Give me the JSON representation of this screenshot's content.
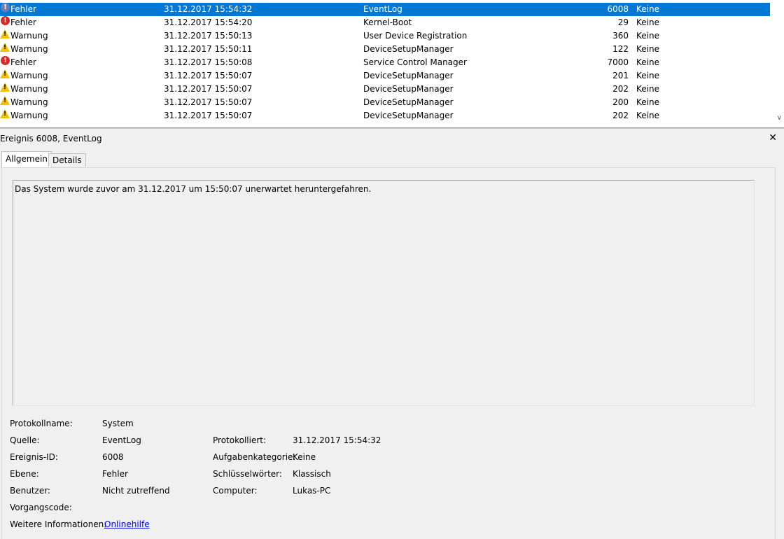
{
  "events": [
    {
      "level": "Fehler",
      "icon": "error-icon",
      "date": "31.12.2017 15:54:32",
      "source": "EventLog",
      "id": "6008",
      "category": "Keine",
      "selected": true
    },
    {
      "level": "Fehler",
      "icon": "error-icon",
      "date": "31.12.2017 15:54:20",
      "source": "Kernel-Boot",
      "id": "29",
      "category": "Keine"
    },
    {
      "level": "Warnung",
      "icon": "warning-icon",
      "date": "31.12.2017 15:50:13",
      "source": "User Device Registration",
      "id": "360",
      "category": "Keine"
    },
    {
      "level": "Warnung",
      "icon": "warning-icon",
      "date": "31.12.2017 15:50:11",
      "source": "DeviceSetupManager",
      "id": "122",
      "category": "Keine"
    },
    {
      "level": "Fehler",
      "icon": "error-icon",
      "date": "31.12.2017 15:50:08",
      "source": "Service Control Manager",
      "id": "7000",
      "category": "Keine"
    },
    {
      "level": "Warnung",
      "icon": "warning-icon",
      "date": "31.12.2017 15:50:07",
      "source": "DeviceSetupManager",
      "id": "201",
      "category": "Keine"
    },
    {
      "level": "Warnung",
      "icon": "warning-icon",
      "date": "31.12.2017 15:50:07",
      "source": "DeviceSetupManager",
      "id": "202",
      "category": "Keine"
    },
    {
      "level": "Warnung",
      "icon": "warning-icon",
      "date": "31.12.2017 15:50:07",
      "source": "DeviceSetupManager",
      "id": "200",
      "category": "Keine"
    },
    {
      "level": "Warnung",
      "icon": "warning-icon",
      "date": "31.12.2017 15:50:07",
      "source": "DeviceSetupManager",
      "id": "202",
      "category": "Keine"
    }
  ],
  "detail": {
    "title": "Ereignis 6008, EventLog",
    "close_icon": "close-icon",
    "tabs": [
      "Allgemein",
      "Details"
    ],
    "message": "Das System wurde zuvor am 31.12.2017 um 15:50:07 unerwartet heruntergefahren.",
    "fields": {
      "log_name_label": "Protokollname:",
      "log_name": "System",
      "source_label": "Quelle:",
      "source": "EventLog",
      "logged_label": "Protokolliert:",
      "logged": "31.12.2017 15:54:32",
      "event_id_label": "Ereignis-ID:",
      "event_id": "6008",
      "task_category_label": "Aufgabenkategorie:",
      "task_category": "Keine",
      "level_label": "Ebene:",
      "level": "Fehler",
      "keywords_label": "Schlüsselwörter:",
      "keywords": "Klassisch",
      "user_label": "Benutzer:",
      "user": "Nicht zutreffend",
      "computer_label": "Computer:",
      "computer": "Lukas-PC",
      "opcode_label": "Vorgangscode:",
      "more_info_label": "Weitere Informationen:",
      "more_info_link": "Onlinehilfe"
    }
  },
  "colors": {
    "selection": "#0078d7",
    "error": "#d42a2a",
    "warning": "#f2c200",
    "link": "#0000ee"
  }
}
